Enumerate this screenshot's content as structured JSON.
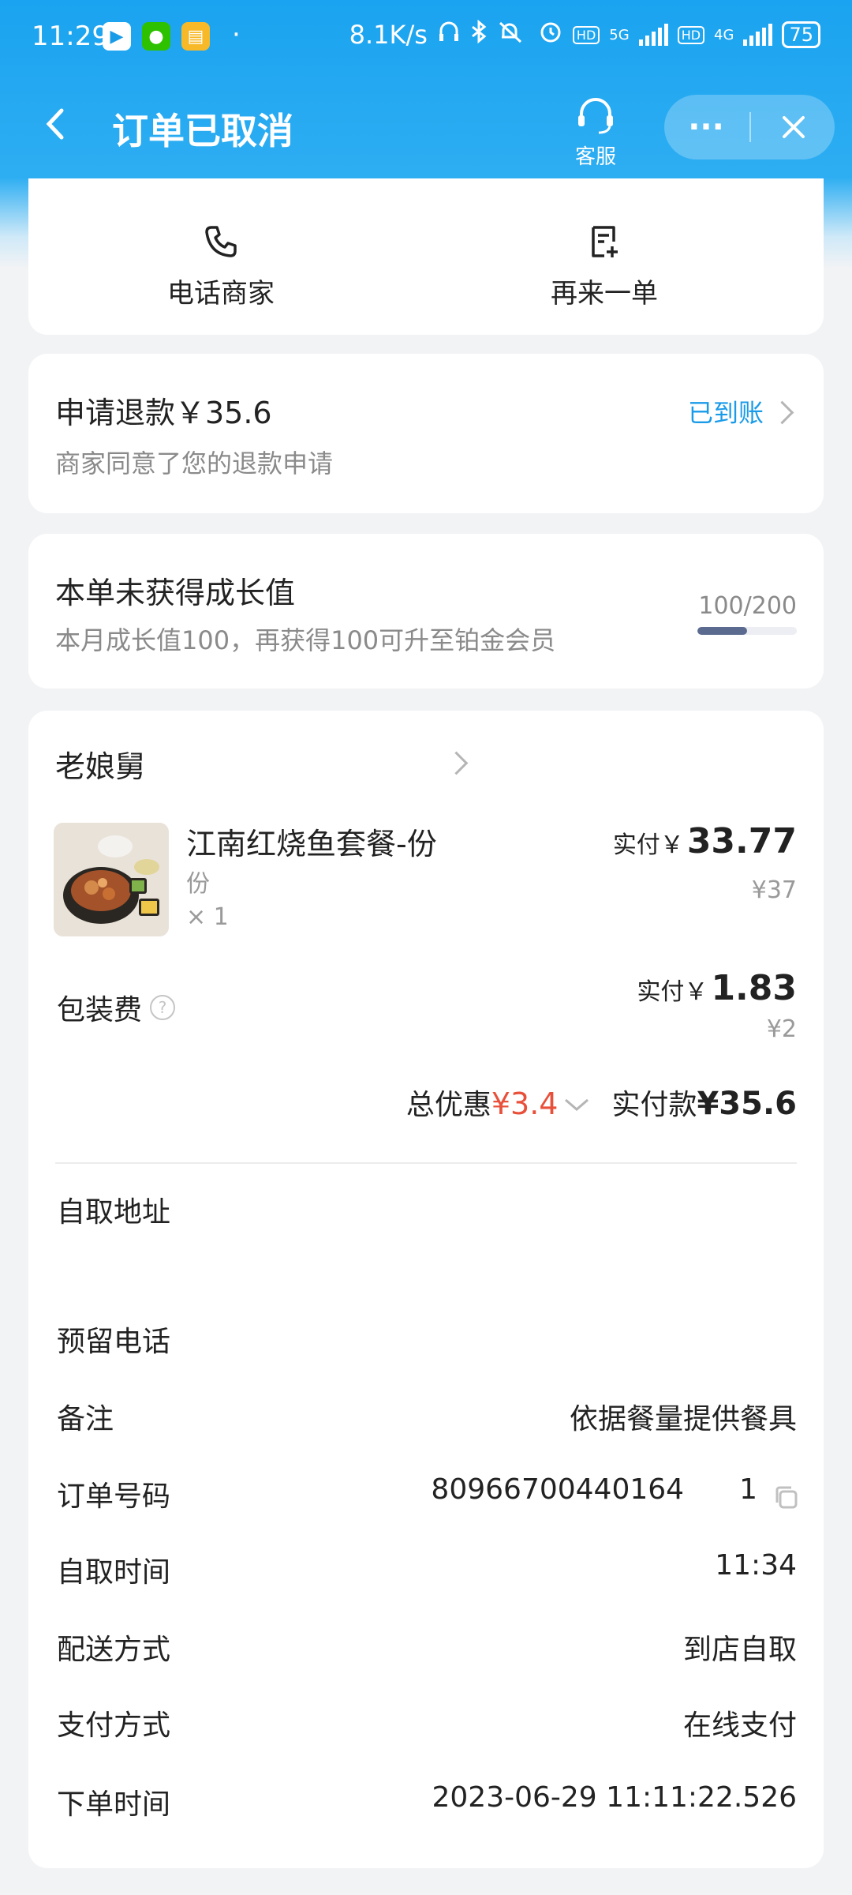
{
  "status_bar": {
    "time": "11:29",
    "dot": "·",
    "net_speed": "8.1K/s",
    "hd1": "HD",
    "net1": "5G",
    "hd2": "HD",
    "net2": "4G",
    "battery": "75"
  },
  "nav": {
    "title": "订单已取消",
    "customer_service": "客服",
    "more": "···"
  },
  "actions": {
    "call_merchant": "电话商家",
    "reorder": "再来一单"
  },
  "refund": {
    "title": "申请退款￥35.6",
    "subtitle": "商家同意了您的退款申请",
    "status": "已到账"
  },
  "growth": {
    "title": "本单未获得成长值",
    "subtitle": "本月成长值100，再获得100可升至铂金会员",
    "value": "100/200",
    "progress": 0.5
  },
  "order": {
    "shop_name": "老娘舅",
    "item": {
      "name": "江南红烧鱼套餐-份",
      "spec": "份",
      "qty": "× 1",
      "paid_label": "实付￥",
      "paid_value": "33.77",
      "original": "¥37"
    },
    "packing": {
      "label": "包装费",
      "paid_label": "实付￥",
      "paid_value": "1.83",
      "original": "¥2"
    },
    "summary": {
      "discount_label": "总优惠",
      "discount_value": "¥3.4",
      "pay_label": "实付款",
      "pay_value": "¥35.6"
    },
    "info": {
      "pickup_address_label": "自取地址",
      "phone_label": "预留电话",
      "note_label": "备注",
      "note_value": "依据餐量提供餐具",
      "order_no_label": "订单号码",
      "order_no_value": "80966700440164",
      "order_no_tail": "1",
      "pickup_time_label": "自取时间",
      "pickup_time_value": "11:34",
      "delivery_label": "配送方式",
      "delivery_value": "到店自取",
      "payment_label": "支付方式",
      "payment_value": "在线支付",
      "order_time_label": "下单时间",
      "order_time_value": "2023-06-29 11:11:22.526"
    }
  },
  "colors": {
    "header_blue": "#1aa3f0",
    "link_blue": "#1a9be8",
    "discount_red": "#e8503a"
  }
}
